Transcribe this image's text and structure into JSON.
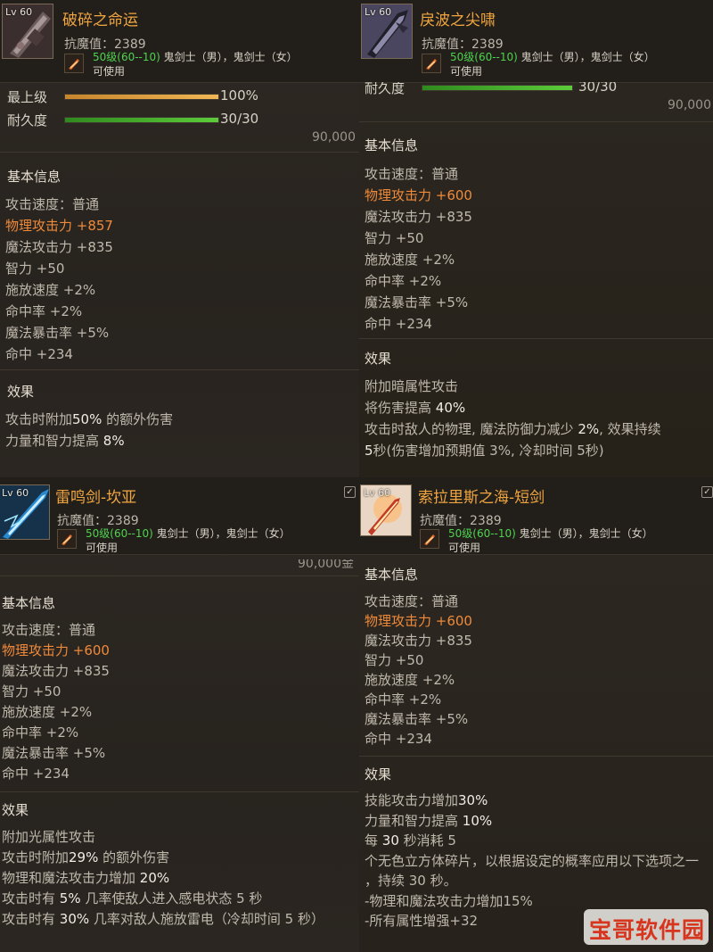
{
  "panels": [
    {
      "level_prefix": "Lv",
      "level": "60",
      "title": "破碎之命运",
      "resist": "抗魔值：2389",
      "req_level": "50级(60--10)",
      "req_jobs": "鬼剑士（男），鬼剑士（女）",
      "usable": "可使用",
      "grade_label": "最上级",
      "grade_value": "100%",
      "grade_percent": 100,
      "dur_label": "耐久度",
      "dur_value": "30/30",
      "dur_percent": 100,
      "price": "90,000",
      "basic_title": "基本信息",
      "stats": [
        "攻击速度：普通",
        "物理攻击力 +857",
        "魔法攻击力 +835",
        "智力 +50",
        "施放速度 +2%",
        "命中率 +2%",
        "魔法暴击率 +5%",
        "命中 +234"
      ],
      "effect_title": "效果",
      "effects": [
        {
          "a": "攻击时附加",
          "b": "50%",
          "c": " 的额外伤害"
        },
        {
          "a": "力量和智力提高 ",
          "b": "8%",
          "c": ""
        }
      ]
    },
    {
      "level_prefix": "Lv",
      "level": "60",
      "title": "戾波之尖啸",
      "resist": "抗魔值：2389",
      "req_level": "50级(60--10)",
      "req_jobs": "鬼剑士（男），鬼剑士（女）",
      "usable": "可使用",
      "dur_label": "耐久度",
      "dur_value": "30/30",
      "dur_percent": 100,
      "price": "90,000",
      "basic_title": "基本信息",
      "stats": [
        "攻击速度：普通",
        "物理攻击力 +600",
        "魔法攻击力 +835",
        "智力 +50",
        "施放速度 +2%",
        "命中率 +2%",
        "魔法暴击率 +5%",
        "命中 +234"
      ],
      "effect_title": "效果",
      "effects": [
        {
          "a": "附加暗属性攻击",
          "b": "",
          "c": ""
        },
        {
          "a": "将伤害提高 ",
          "b": "40%",
          "c": ""
        },
        {
          "a": "攻击时敌人的物理, 魔法防御力减少 ",
          "b": "2%",
          "c": ", 效果持续"
        },
        {
          "a": "",
          "b": "5",
          "c": "秒(伤害增加预期值 3%, 冷却时间 5秒)"
        }
      ]
    },
    {
      "level_prefix": "Lv",
      "level": "60",
      "title": "雷鸣剑-坎亚",
      "resist": "抗魔值：2389",
      "req_level": "50级(60--10)",
      "req_jobs": "鬼剑士（男），鬼剑士（女）",
      "usable": "可使用",
      "price": "90,000金",
      "basic_title": "基本信息",
      "stats": [
        "攻击速度：普通",
        "物理攻击力 +600",
        "魔法攻击力 +835",
        "智力 +50",
        "施放速度 +2%",
        "命中率 +2%",
        "魔法暴击率 +5%",
        "命中 +234"
      ],
      "effect_title": "效果",
      "effects": [
        {
          "a": "附加光属性攻击",
          "b": "",
          "c": ""
        },
        {
          "a": "攻击时附加",
          "b": "29%",
          "c": " 的额外伤害"
        },
        {
          "a": "物理和魔法攻击力增加 ",
          "b": "20%",
          "c": ""
        },
        {
          "a": "攻击时有 ",
          "b": "5%",
          "c": " 几率使敌人进入感电状态 5 秒"
        },
        {
          "a": "攻击时有 ",
          "b": "30%",
          "c": " 几率对敌人施放雷电（冷却时间 5 秒）"
        }
      ]
    },
    {
      "level_prefix": "Lv",
      "level": "60",
      "title": "索拉里斯之海-短剑",
      "resist": "抗魔值：2389",
      "req_level": "50级(60--10)",
      "req_jobs": "鬼剑士（男），鬼剑士（女）",
      "usable": "可使用",
      "basic_title": "基本信息",
      "stats": [
        "攻击速度：普通",
        "物理攻击力 +600",
        "魔法攻击力 +835",
        "智力 +50",
        "施放速度 +2%",
        "命中率 +2%",
        "魔法暴击率 +5%",
        "命中 +234"
      ],
      "effect_title": "效果",
      "effects": [
        {
          "a": "技能攻击力增加",
          "b": "30%",
          "c": ""
        },
        {
          "a": "力量和智力提高 ",
          "b": "10%",
          "c": ""
        },
        {
          "a": "每 ",
          "b": "30",
          "c": " 秒消耗 5"
        },
        {
          "a": "个无色立方体碎片，以根据设定的概率应用以下选项之一",
          "b": "",
          "c": ""
        },
        {
          "a": "，持续 30 秒。",
          "b": "",
          "c": ""
        },
        {
          "a": "-物理和魔法攻击力增加15%",
          "b": "",
          "c": ""
        },
        {
          "a": "-所有属性增强+32",
          "b": "",
          "c": ""
        }
      ]
    }
  ],
  "watermark": "宝哥软件园",
  "colors": {
    "title": "#f0a640",
    "highlight": "#ef8a3a",
    "requirement": "#4fd24f",
    "grade_bar": "#e0a23a",
    "durability_bar": "#47b82d"
  }
}
